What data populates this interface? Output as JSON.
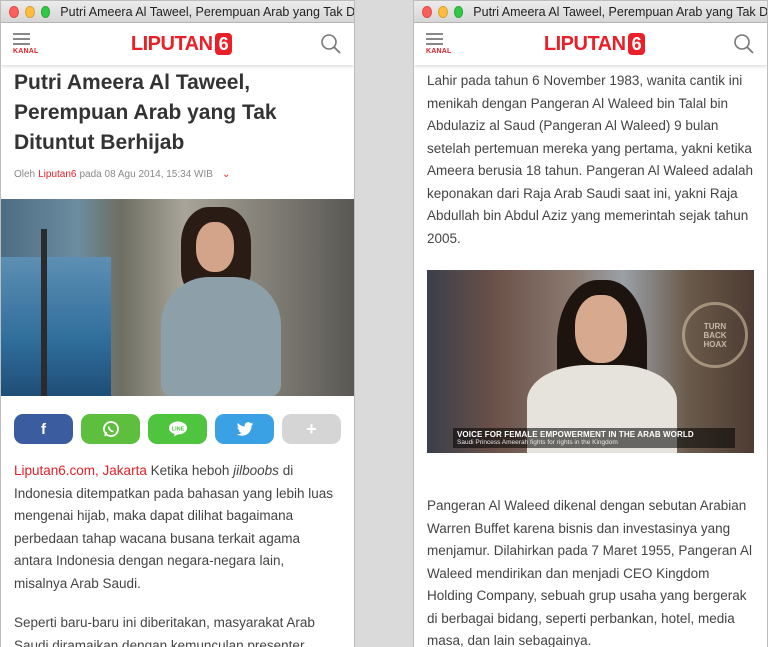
{
  "left_window": {
    "title": "Putri Ameera Al Taweel, Perempuan Arab yang Tak Dituntut Berhijab",
    "kanal_label": "KANAL",
    "logo_text": "LIPUTAN",
    "logo_number": "6",
    "headline": "Putri Ameera Al Taweel, Perempuan Arab yang Tak Dituntut Berhijab",
    "byline_prefix": "Oleh",
    "byline_author": "Liputan6",
    "byline_date": "pada 08 Agu 2014, 15:34 WIB",
    "share_buttons": [
      {
        "name": "facebook",
        "glyph": "f"
      },
      {
        "name": "whatsapp",
        "glyph": "✆"
      },
      {
        "name": "line",
        "glyph": "LINE"
      },
      {
        "name": "twitter",
        "glyph": "🐦"
      },
      {
        "name": "more",
        "glyph": "+"
      }
    ],
    "lead_location": "Liputan6.com, Jakarta",
    "lead_text_1": " Ketika heboh ",
    "lead_italic": "jilboobs",
    "lead_text_2": " di Indonesia ditempatkan pada bahasan yang lebih luas mengenai hijab, maka dapat dilihat bagaimana perbedaan tahap wacana busana terkait agama antara Indonesia dengan negara-negara lain, misalnya Arab Saudi.",
    "paragraph_2": "Seperti baru-baru ini diberitakan, masyarakat Arab Saudi diramaikan dengan kemunculan presenter"
  },
  "right_window": {
    "title": "Putri Ameera Al Taweel, Perempuan Arab yang Tak Dituntut Berhijab",
    "kanal_label": "KANAL",
    "logo_text": "LIPUTAN",
    "logo_number": "6",
    "paragraph_1": "Lahir pada tahun 6 November 1983, wanita cantik ini menikah dengan Pangeran Al Waleed bin Talal bin Abdulaziz al Saud (Pangeran Al Waleed) 9 bulan setelah pertemuan mereka yang pertama, yakni ketika Ameera berusia 18 tahun. Pangeran Al Waleed adalah keponakan dari Raja Arab Saudi saat ini, yakni Raja Abdullah bin Abdul Aziz yang memerintah sejak tahun 2005.",
    "caption_title": "VOICE FOR FEMALE EMPOWERMENT IN THE ARAB WORLD",
    "caption_sub": "Saudi Princess Ameerah fights for rights in the Kingdom",
    "badge_text": "TURN BACK HOAX",
    "paragraph_2": "Pangeran Al Waleed dikenal dengan sebutan Arabian Warren Buffet karena bisnis dan investasinya yang menjamur. Dilahirkan pada 7 Maret 1955, Pangeran Al Waleed mendirikan dan menjadi CEO Kingdom Holding Company, sebuah grup usaha yang bergerak di berbagai bidang, seperti perbankan, hotel, media masa, dan lain sebagainya."
  },
  "colors": {
    "brand_red": "#e21f26",
    "facebook": "#3b5c9e",
    "whatsapp": "#5dbf3d",
    "line": "#4ec43f",
    "twitter": "#3aa2e4",
    "more": "#d5d5d5"
  }
}
